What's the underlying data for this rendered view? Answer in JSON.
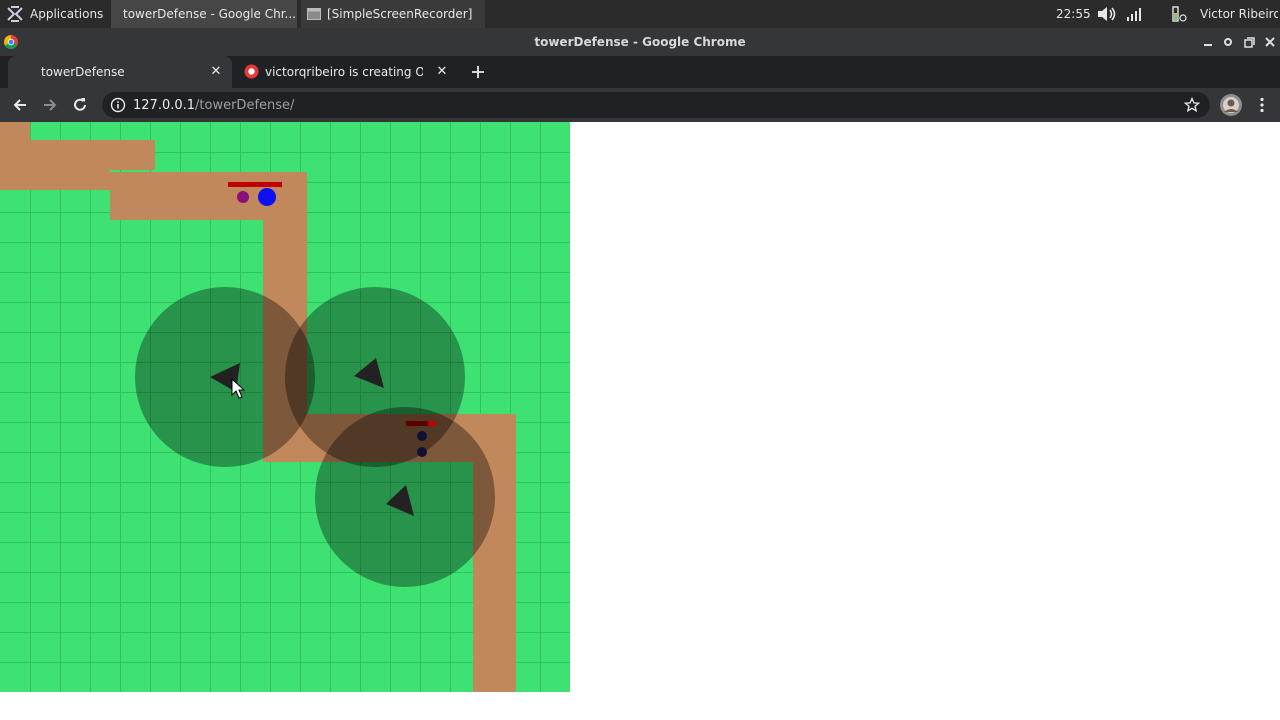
{
  "taskbar": {
    "apps_label": "Applications",
    "windows": [
      {
        "label": "towerDefense - Google Chr...",
        "icon": "chrome-icon"
      },
      {
        "label": "[SimpleScreenRecorder]",
        "icon": "window-icon"
      }
    ],
    "clock": "22:55",
    "user": "Victor Ribeiro"
  },
  "window": {
    "title": "towerDefense - Google Chrome"
  },
  "tabs": [
    {
      "label": "towerDefense",
      "active": true
    },
    {
      "label": "victorqribeiro is creating Open",
      "active": false
    }
  ],
  "address": {
    "host": "127.0.0.1",
    "path": "/towerDefense/"
  },
  "game": {
    "colors": {
      "grass": "#3ee272",
      "grid": "#2fc25e",
      "path": "#c1885b",
      "path_dark": "#b07a50",
      "tower": "#222222",
      "range": "#000000",
      "health_bar": "#c00000",
      "enemy_blue": "#0d10f5",
      "enemy_purple": "#8b0f7a",
      "enemy_dark": "#101030"
    },
    "grid_cells": 19,
    "towers": [
      {
        "name": "tower-1",
        "facing": "left"
      },
      {
        "name": "tower-2",
        "facing": "upper-left"
      },
      {
        "name": "tower-3",
        "facing": "upper-left"
      }
    ]
  }
}
